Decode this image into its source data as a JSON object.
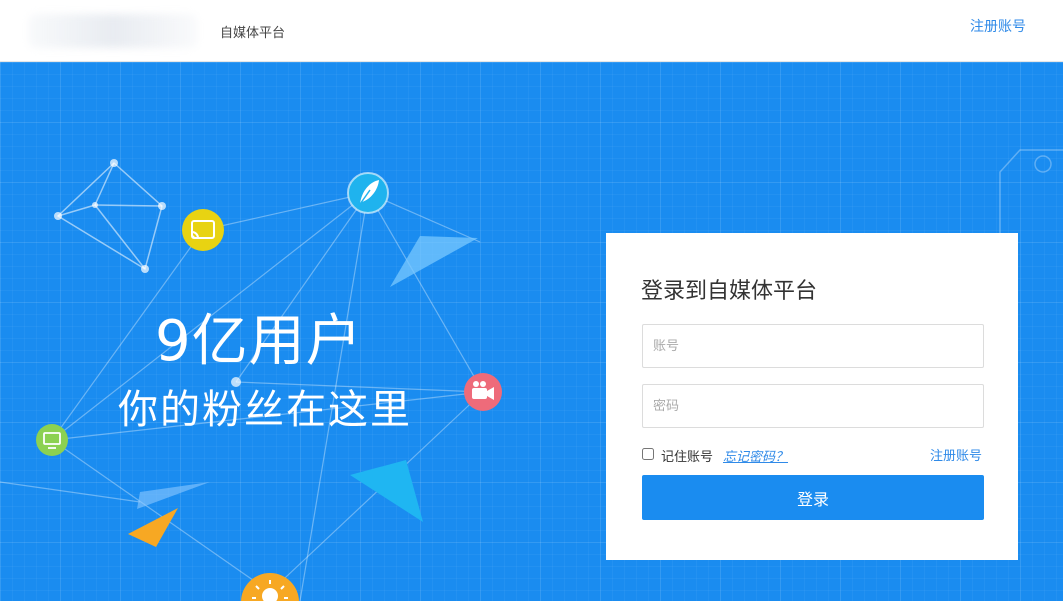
{
  "header": {
    "brand": "自媒体平台",
    "register_link": "注册账号"
  },
  "hero": {
    "headline": "9亿用户",
    "subheadline": "你的粉丝在这里",
    "icons": [
      "cast-icon",
      "feather-icon",
      "video-camera-icon",
      "monitor-icon",
      "lightbulb-icon"
    ]
  },
  "login": {
    "title": "登录到自媒体平台",
    "account_placeholder": "账号",
    "password_placeholder": "密码",
    "remember_label": "记住账号",
    "forgot_link": "忘记密码？",
    "register_link": "注册账号",
    "submit_label": "登录"
  },
  "colors": {
    "accent": "#1a8cf0",
    "link": "#2f8ae8",
    "cast_icon_bg": "#e8d312",
    "feather_icon_bg": "#1fb3ee",
    "camera_icon_bg": "#ee6b7a",
    "monitor_icon_bg": "#8cd151",
    "lightbulb_icon_bg": "#f7a823"
  }
}
